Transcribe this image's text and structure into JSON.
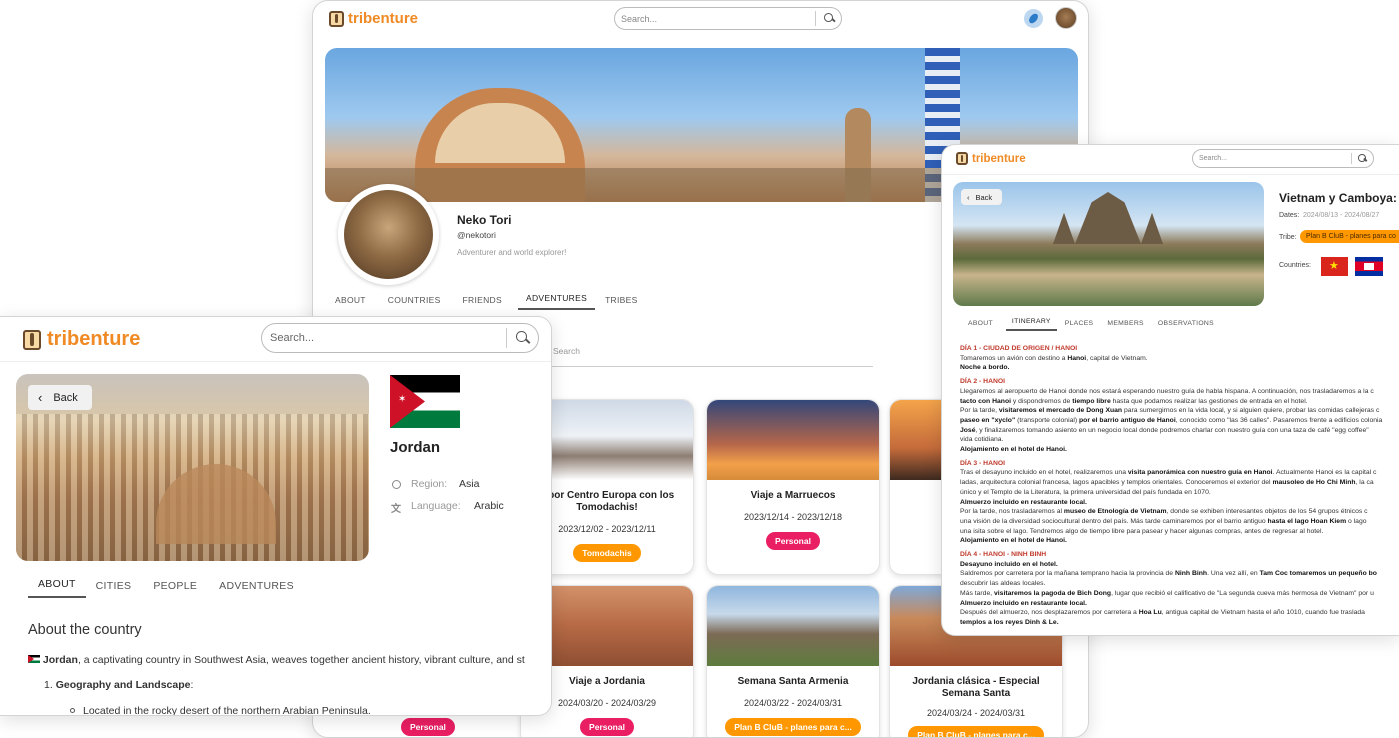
{
  "brand": {
    "name": "tribenture",
    "color": "#f08a24"
  },
  "profile_window": {
    "search_placeholder": "Search...",
    "user": {
      "name": "Neko Tori",
      "handle": "@nekotori",
      "bio": "Adventurer and world explorer!"
    },
    "tabs": [
      {
        "label": "ABOUT",
        "active": false
      },
      {
        "label": "COUNTRIES",
        "active": false
      },
      {
        "label": "FRIENDS",
        "active": false
      },
      {
        "label": "ADVENTURES",
        "active": true
      },
      {
        "label": "TRIBES",
        "active": false
      }
    ],
    "adventures_search_placeholder": "Search",
    "cards": [
      {
        "title": "e por Centro Europa con los Tomodachis!",
        "dates": "2023/12/02 - 2023/12/11",
        "tag": "Tomodachis",
        "tag_color": "#ff9800"
      },
      {
        "title": "Viaje a Marruecos",
        "dates": "2023/12/14 - 2023/12/18",
        "tag": "Personal",
        "tag_color": "#e91e63"
      },
      {
        "title": "Viaje a Jordania",
        "dates": "2024/03/20 - 2024/03/29",
        "tag": "Personal",
        "tag_color": "#e91e63"
      },
      {
        "title": "Semana Santa Armenia",
        "dates": "2024/03/22 - 2024/03/31",
        "tag": "Plan B CluB - planes para c...",
        "tag_color": "#ff9800"
      },
      {
        "title": "Jordania clásica - Especial Semana Santa",
        "dates": "2024/03/24 - 2024/03/31",
        "tag": "Plan B CluB - planes para c...",
        "tag_color": "#ff9800"
      }
    ],
    "hidden_card_tag": "Personal"
  },
  "jordan_window": {
    "search_placeholder": "Search...",
    "back_label": "Back",
    "country": "Jordan",
    "region_label": "Region:",
    "region_value": "Asia",
    "language_label": "Language:",
    "language_value": "Arabic",
    "tabs": [
      {
        "label": "ABOUT",
        "active": true
      },
      {
        "label": "CITIES",
        "active": false
      },
      {
        "label": "PEOPLE",
        "active": false
      },
      {
        "label": "ADVENTURES",
        "active": false
      }
    ],
    "section_title": "About the country",
    "intro_bold": "Jordan",
    "intro_text": ", a captivating country in Southwest Asia, weaves together ancient history, vibrant culture, and st",
    "list_item_bold": "Geography and Landscape",
    "list_item_suffix": ":",
    "sub_item": "Located in the rocky desert of the northern Arabian Peninsula."
  },
  "trip_window": {
    "search_placeholder": "Search...",
    "back_label": "Back",
    "title": "Vietnam y Camboya:",
    "dates_label": "Dates:",
    "dates_value": "2024/08/13 - 2024/08/27",
    "tribe_label": "Tribe:",
    "tribe_value": "Plan B CluB - planes para co",
    "countries_label": "Countries:",
    "tabs": [
      {
        "label": "ABOUT",
        "active": false
      },
      {
        "label": "ITINERARY",
        "active": true
      },
      {
        "label": "PLACES",
        "active": false
      },
      {
        "label": "MEMBERS",
        "active": false
      },
      {
        "label": "OBSERVATIONS",
        "active": false
      }
    ],
    "itinerary": [
      {
        "day": "DÍA 1 - CIUDAD DE ORIGEN / HANOI",
        "lines": [
          "Tomaremos un avión con destino a <b>Hanoi</b>, capital de Vietnam.",
          "<b>Noche a bordo.</b>"
        ]
      },
      {
        "day": "DÍA 2 - HANOI",
        "lines": [
          "Llegaremos al aeropuerto de Hanoi donde nos estará esperando nuestro guía de habla hispana. A continuación, nos trasladaremos a la c",
          "<b>tacto con Hanoi</b> y dispondremos de <b>tiempo libre</b> hasta que podamos realizar las gestiones de entrada en el hotel.",
          "Por la tarde, <b>visitaremos el mercado de Dong Xuan</b> para sumergirnos en la vida local, y si alguien quiere, probar las comidas callejeras c",
          "<b>paseo en \"xyclo\"</b> (transporte colonial) <b>por el barrio antiguo de Hanoi</b>, conocido como \"las 36 calles\". Pasaremos frente a edificios colonia",
          "<b>José</b>, y finalizaremos tomando asiento en un negocio local donde podremos charlar con nuestro guía con una taza de café \"egg coffee\"",
          "vida cotidiana.",
          "<b>Alojamiento en el hotel de Hanoi.</b>"
        ]
      },
      {
        "day": "DÍA 3 - HANOI",
        "lines": [
          "Tras el desayuno incluido en el hotel, realizaremos una <b>visita panorámica con nuestro guía en Hanoi</b>. Actualmente Hanoi es la capital c",
          "ladas, arquitectura colonial francesa, lagos apacibles y templos orientales. Conoceremos el exterior del <b>mausoleo de Ho Chi Minh</b>, la ca",
          "único y el Templo de la Literatura, la primera universidad del país fundada en 1070.",
          "<b>Almuerzo incluido en restaurante local.</b>",
          "Por la tarde, nos trasladaremos al <b>museo de Etnología de Vietnam</b>, donde se exhiben interesantes objetos de los 54 grupos étnicos c",
          "una visión de la diversidad sociocultural dentro del país. Más tarde caminaremos por el barrio antiguo <b>hasta el lago Hoan Kiem</b> o lago",
          "una isita sobre el lago. Tendremos algo de tiempo libre para pasear y hacer algunas compras, antes de regresar al hotel.",
          "<b>Alojamiento en el hotel de Hanoi.</b>"
        ]
      },
      {
        "day": "DÍA 4 - HANOI - NINH BINH",
        "lines": [
          "<b>Desayuno incluido en el hotel.</b>",
          "Saldremos por carretera por la mañana temprano hacia la provincia de <b>Ninh Binh</b>. Una vez allí, en <b>Tam Coc tomaremos un pequeño bo</b>",
          "descubrir las aldeas locales.",
          "Más tarde, <b>visitaremos la pagoda de Bich Dong</b>, lugar que recibió el calificativo de \"La segunda cueva más hermosa de Vietnam\" por u",
          "<b>Almuerzo incluido en restaurante local.</b>",
          "Después del almuerzo, nos desplazaremos por carretera a <b>Hoa Lu</b>, antigua capital de Vietnam hasta el año 1010, cuando fue traslada",
          "<b>templos a los reyes Dinh & Le.</b>"
        ]
      }
    ]
  }
}
